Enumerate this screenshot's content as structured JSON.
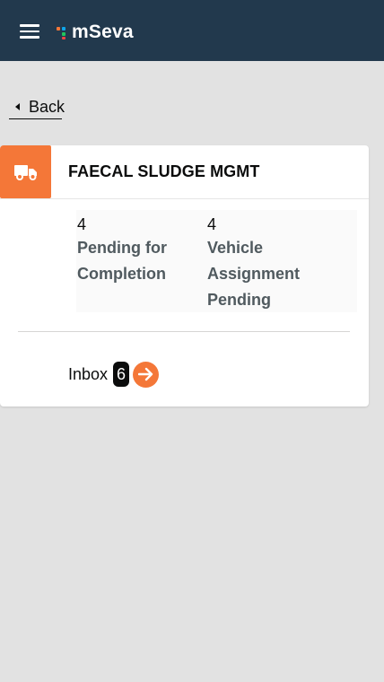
{
  "header": {
    "brand": "mSeva",
    "menu_icon": "hamburger-menu-icon",
    "logo_colors": [
      "#f47738",
      "#0ea5e9",
      "#22c55e",
      "#ef4444"
    ]
  },
  "back": {
    "label": "Back",
    "icon": "caret-left-icon"
  },
  "card": {
    "title": "FAECAL SLUDGE MGMT",
    "icon": "truck-icon",
    "accent_color": "#f47738",
    "metrics": [
      {
        "value": "4",
        "label": "Pending for Completion"
      },
      {
        "value": "4",
        "label": "Vehicle Assignment Pending"
      }
    ],
    "inbox": {
      "label": "Inbox",
      "count": "6",
      "icon": "arrow-right-circle-icon"
    }
  }
}
